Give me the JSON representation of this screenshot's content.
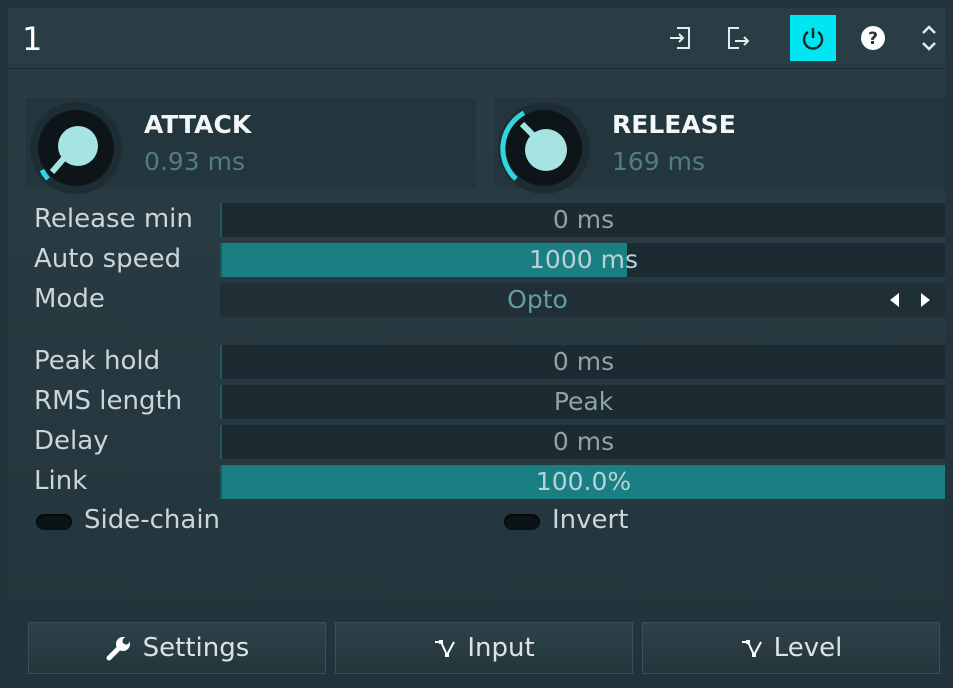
{
  "header": {
    "title": "1",
    "icons": [
      "import-preset-icon",
      "export-preset-icon",
      "power-icon",
      "help-icon",
      "expand-collapse-icon"
    ],
    "power_color": "#00e5f2"
  },
  "attack": {
    "label": "ATTACK",
    "value": "0.93 ms",
    "level": 0.05
  },
  "release": {
    "label": "RELEASE",
    "value": "169 ms",
    "level": 0.35
  },
  "rows": {
    "release_min": {
      "label": "Release min",
      "value": "0 ms",
      "fill": 0.0
    },
    "auto_speed": {
      "label": "Auto speed",
      "value": "1000 ms",
      "fill": 0.56
    },
    "mode": {
      "label": "Mode",
      "value": "Opto"
    },
    "peak_hold": {
      "label": "Peak hold",
      "value": "0 ms",
      "fill": 0.0
    },
    "rms_length": {
      "label": "RMS length",
      "value": "Peak",
      "fill": 0.0
    },
    "delay": {
      "label": "Delay",
      "value": "0 ms",
      "fill": 0.0
    },
    "link": {
      "label": "Link",
      "value": "100.0%",
      "fill": 1.0
    }
  },
  "toggles": {
    "side_chain": {
      "label": "Side-chain",
      "on": false
    },
    "invert": {
      "label": "Invert",
      "on": false
    }
  },
  "tabs": {
    "settings": "Settings",
    "input": "Input",
    "level": "Level"
  },
  "colors": {
    "accent": "#1a7f83",
    "knob_arc": "#2fd6e0",
    "knob_face": "#a6e3e3"
  }
}
